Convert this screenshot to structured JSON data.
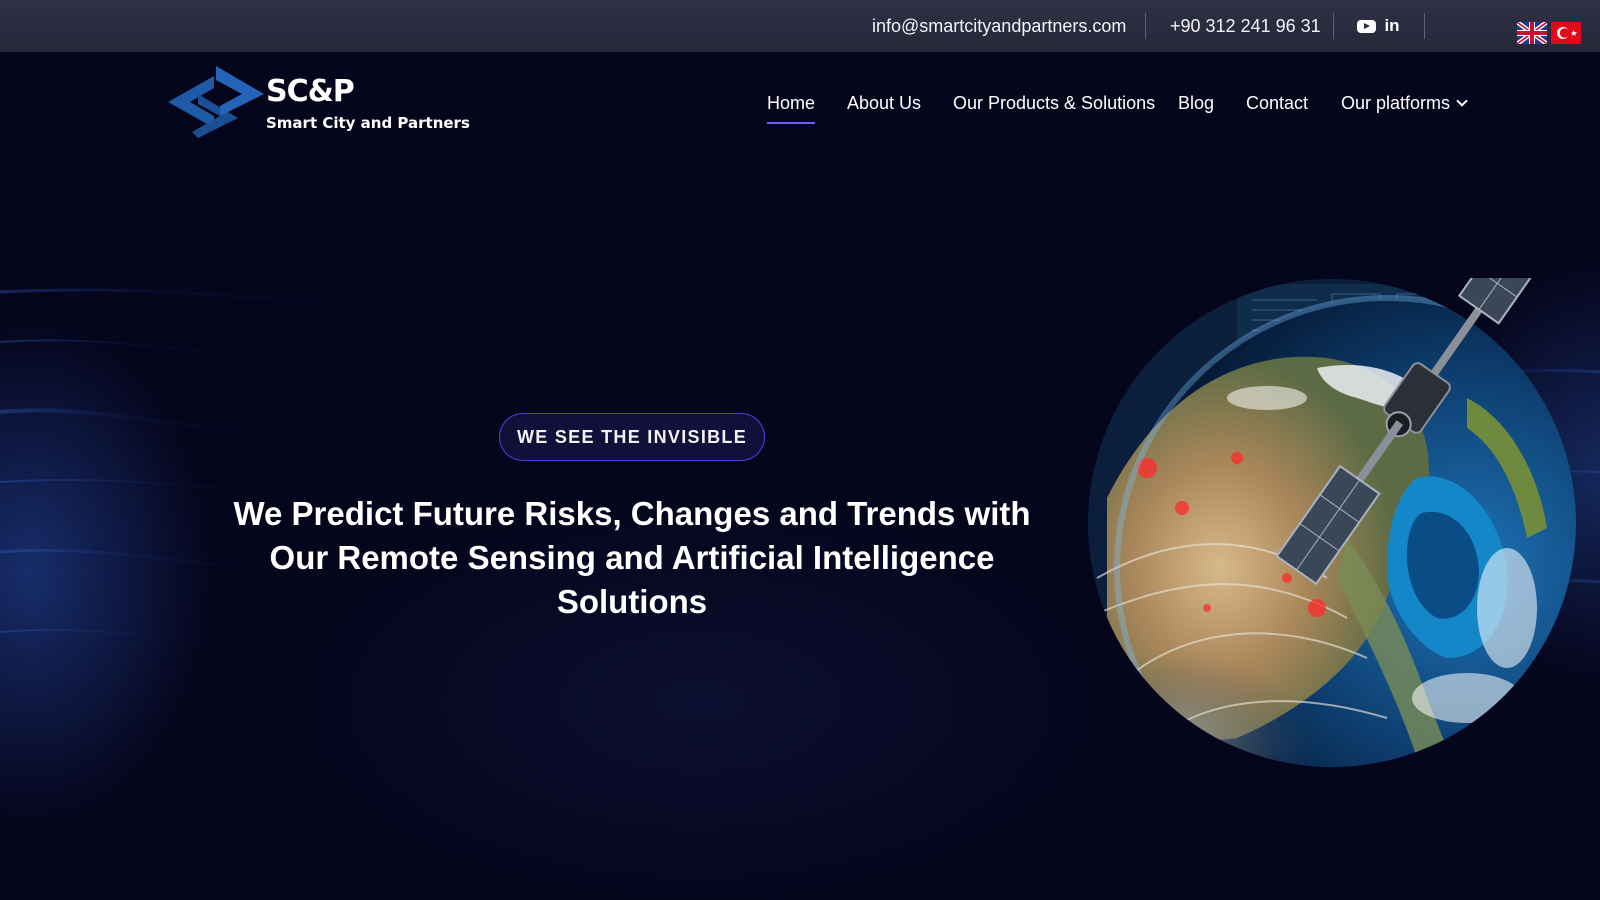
{
  "topbar": {
    "email": "info@smartcityandpartners.com",
    "phone": "+90 312 241 96 31",
    "social": [
      {
        "icon": "youtube-icon"
      },
      {
        "icon": "linkedin-icon",
        "glyph": "in"
      }
    ],
    "languages": [
      {
        "icon": "uk-flag-icon"
      },
      {
        "icon": "turkey-flag-icon"
      }
    ]
  },
  "logo": {
    "title": "SC&P",
    "subtitle": "Smart City and Partners",
    "color": "#1f5aa6"
  },
  "nav": {
    "items": [
      {
        "label": "Home",
        "active": true
      },
      {
        "label": "About Us"
      },
      {
        "label": "Our Products & Solutions"
      },
      {
        "label": "Blog"
      },
      {
        "label": "Contact"
      },
      {
        "label": "Our platforms",
        "has_dropdown": true
      }
    ]
  },
  "hero": {
    "badge": "WE SEE THE INVISIBLE",
    "title": "We Predict Future Risks, Changes and Trends with Our Remote Sensing and Artificial Intelligence Solutions",
    "image": "earth-satellite-illustration"
  },
  "colors": {
    "background": "#05051c",
    "topbar": "#2b2c3e",
    "accent": "#6d5bff",
    "badge_border": "#4f3fe0"
  }
}
